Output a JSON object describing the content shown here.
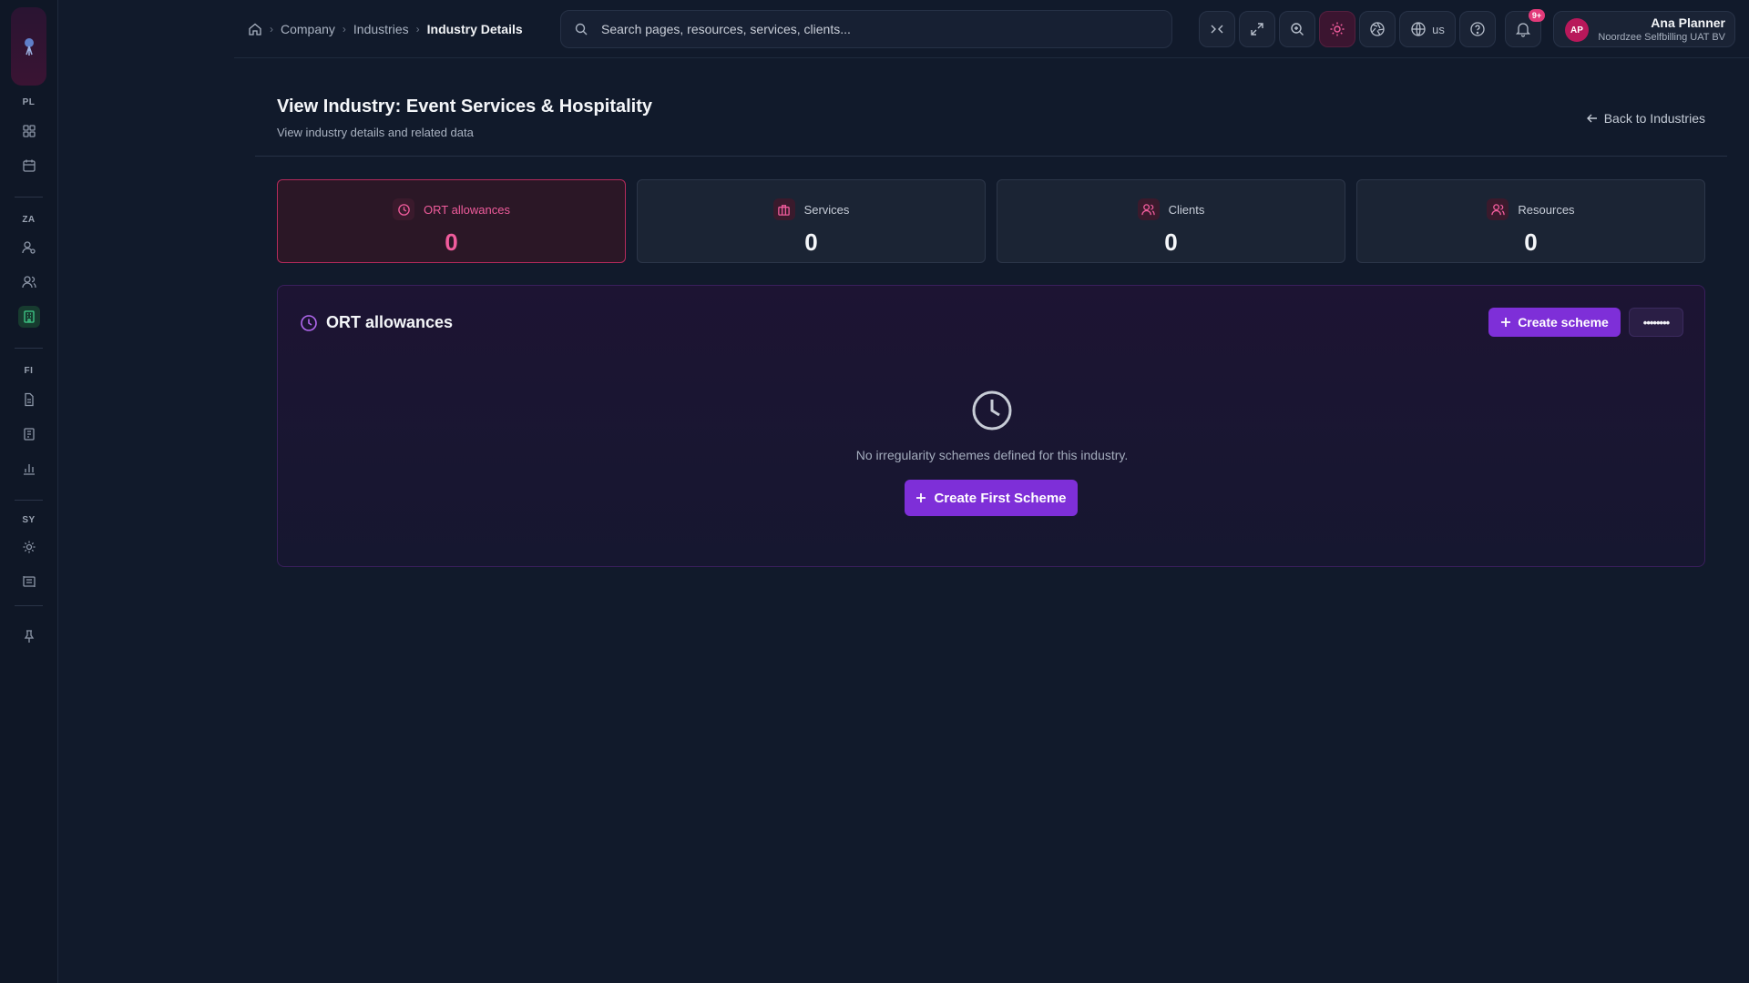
{
  "sidebar": {
    "sections": [
      {
        "label": "PL",
        "items": [
          {
            "icon": "dashboard-icon"
          },
          {
            "icon": "calendar-icon"
          }
        ]
      },
      {
        "label": "ZA",
        "items": [
          {
            "icon": "user-settings-icon"
          },
          {
            "icon": "users-icon"
          },
          {
            "icon": "building-icon",
            "active": true
          }
        ]
      },
      {
        "label": "FI",
        "items": [
          {
            "icon": "document-icon"
          },
          {
            "icon": "invoice-icon"
          },
          {
            "icon": "bar-chart-icon"
          }
        ]
      },
      {
        "label": "SY",
        "items": [
          {
            "icon": "gear-icon"
          },
          {
            "icon": "log-icon"
          }
        ]
      }
    ],
    "active_color": "#3fce8a"
  },
  "breadcrumb": {
    "items": [
      "Company",
      "Industries"
    ],
    "current": "Industry Details"
  },
  "search": {
    "placeholder": "Search pages, resources, services, clients..."
  },
  "toolbar": {
    "language": "us",
    "notifications_badge": "9+"
  },
  "user": {
    "initials": "AP",
    "name": "Ana Planner",
    "org": "Noordzee Selfbilling UAT BV"
  },
  "page": {
    "title": "View Industry: Event Services & Hospitality",
    "subtitle": "View industry details and related data",
    "back_label": "Back to Industries"
  },
  "stats": [
    {
      "label": "ORT allowances",
      "value": "0",
      "icon": "clock-icon",
      "active": true
    },
    {
      "label": "Services",
      "value": "0",
      "icon": "briefcase-icon"
    },
    {
      "label": "Clients",
      "value": "0",
      "icon": "users-icon"
    },
    {
      "label": "Resources",
      "value": "0",
      "icon": "users-icon"
    }
  ],
  "panel": {
    "title": "ORT allowances",
    "create_label": "Create scheme",
    "more_label": "••••••••",
    "empty_text": "No irregularity schemes defined for this industry.",
    "create_first_label": "Create First Scheme"
  },
  "colors": {
    "accent_purple": "#7e2fd8",
    "accent_pink": "#f05c9c",
    "background": "#111a2b"
  }
}
